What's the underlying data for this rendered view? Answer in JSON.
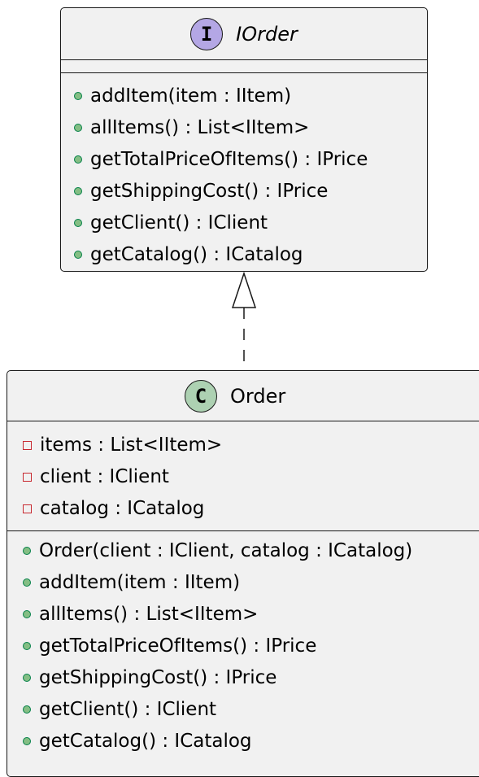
{
  "interface": {
    "stereotype_letter": "I",
    "name": "IOrder",
    "methods": [
      "addItem(item : IItem)",
      "allItems() : List<IItem>",
      "getTotalPriceOfItems() : IPrice",
      "getShippingCost() : IPrice",
      "getClient() : IClient",
      "getCatalog() : ICatalog"
    ]
  },
  "class": {
    "stereotype_letter": "C",
    "name": "Order",
    "fields": [
      "items : List<IItem>",
      "client : IClient",
      "catalog : ICatalog"
    ],
    "methods": [
      "Order(client : IClient, catalog : ICatalog)",
      "addItem(item : IItem)",
      "allItems() : List<IItem>",
      "getTotalPriceOfItems() : IPrice",
      "getShippingCost() : IPrice",
      "getClient() : IClient",
      "getCatalog() : ICatalog"
    ]
  },
  "relationship": {
    "type": "realization",
    "from": "Order",
    "to": "IOrder"
  },
  "colors": {
    "box_fill": "#f1f1f1",
    "border": "#181818",
    "interface_badge": "#b4a7e5",
    "class_badge": "#add1b2",
    "public_marker": "#84be84",
    "private_marker": "#c82930"
  }
}
